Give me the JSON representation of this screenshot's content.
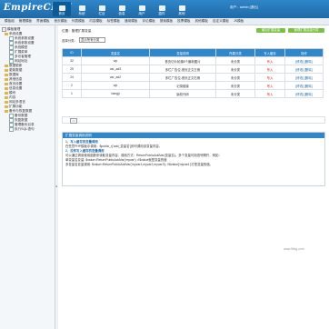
{
  "header": {
    "logo": "EmpireCMS",
    "logo_sup": "7",
    "nav": [
      {
        "label": "首页"
      },
      {
        "label": "系统"
      },
      {
        "label": "栏目"
      },
      {
        "label": "信息"
      },
      {
        "label": "用户"
      },
      {
        "label": "插件"
      },
      {
        "label": "其他"
      }
    ],
    "user": "用户：admin [退出]"
  },
  "menubar": [
    "模板组",
    "管理模板",
    "界面模板",
    "首页模板",
    "列表模板",
    "内容模板",
    "标签模板",
    "通用模板",
    "评论模板",
    "搜索模板",
    "投票模板",
    "其他模板",
    "自定义模板",
    "JS模板"
  ],
  "sidebar": {
    "items": [
      {
        "label": "模板管理",
        "level": 0,
        "type": "tree"
      },
      {
        "label": "系统设置",
        "level": 1,
        "type": "folder"
      },
      {
        "label": "系统参数设置",
        "level": 2,
        "type": "doc"
      },
      {
        "label": "系统参数设置",
        "level": 2,
        "type": "doc"
      },
      {
        "label": "系统模型",
        "level": 2,
        "type": "doc"
      },
      {
        "label": "扩展菜单",
        "level": 2,
        "type": "doc"
      },
      {
        "label": "多访者管理",
        "level": 2,
        "type": "doc"
      },
      {
        "label": "网站地址",
        "level": 2,
        "type": "doc"
      },
      {
        "label": "数据更新",
        "level": 1,
        "type": "folder"
      },
      {
        "label": "更新数据",
        "level": 1,
        "type": "folder"
      },
      {
        "label": "数据库",
        "level": 1,
        "type": "folder"
      },
      {
        "label": "其他信息",
        "level": 1,
        "type": "folder"
      },
      {
        "label": "首页设置",
        "level": 1,
        "type": "folder"
      },
      {
        "label": "信息设置",
        "level": 1,
        "type": "folder"
      },
      {
        "label": "模块",
        "level": 1,
        "type": "folder"
      },
      {
        "label": "内容",
        "level": 1,
        "type": "folder"
      },
      {
        "label": "网站多语言",
        "level": 1,
        "type": "folder"
      },
      {
        "label": "扩展功能",
        "level": 1,
        "type": "folder"
      },
      {
        "label": "备份与恢复数据",
        "level": 1,
        "type": "folder"
      },
      {
        "label": "备份数据",
        "level": 2,
        "type": "doc"
      },
      {
        "label": "恢复数据",
        "level": 2,
        "type": "doc"
      },
      {
        "label": "管理备份目录",
        "level": 2,
        "type": "doc"
      },
      {
        "label": "执行SQL语句",
        "level": 2,
        "type": "doc"
      }
    ]
  },
  "main": {
    "breadcrumb": "位置：管理扩展变量",
    "btn_add": "增加扩展变量",
    "btn_manage": "管理扩展变量分类",
    "select_label": "选择分类：",
    "select_value": "显示所有分类",
    "columns": [
      "ID",
      "变量名",
      "变量说明",
      "所属分类",
      "写入缓存",
      "操作"
    ],
    "rows": [
      {
        "id": "32",
        "name": "wp",
        "desc": "首页切片轮播5个最新图片",
        "cat": "未分类",
        "cache": "写入",
        "ops": "[修改] [删除]"
      },
      {
        "id": "25",
        "name": "var_ad3",
        "desc": "多栏广告位-首页正文左侧",
        "cat": "未分类",
        "cache": "写入",
        "ops": "[修改] [删除]"
      },
      {
        "id": "24",
        "name": "var_ad2",
        "desc": "多栏广告位-首页正文右侧",
        "cat": "未分类",
        "cache": "写入",
        "ops": "[修改] [删除]"
      },
      {
        "id": "2",
        "name": "wp",
        "desc": "记录链接",
        "cat": "未分类",
        "cache": "写入",
        "ops": "[修改] [删除]"
      },
      {
        "id": "1",
        "name": "bangji",
        "desc": "版权代码",
        "cat": "未分类",
        "cache": "写入",
        "ops": "[修改] [删除]"
      }
    ],
    "pager_btn": "<<"
  },
  "notes": {
    "title": "扩展变量调用说明",
    "h1": "1、写入缓存的变量调用",
    "p1": "在任意PHP模板中调用：$public_r['add_变量名']即可调用该变量内容。",
    "h2": "2、没有写入缓存的变量调用",
    "p2": "可以通过调用使用函数来读取变量内容。调用方式：ReturnPublicAddVar(变量名)。多个变量可用逗号隔开，例如：",
    "p3": "单变量名变量: $value=ReturnPublicAddVar('myvar'); //$value就是变量的值",
    "p4": "多变量名变量调用: $value=ReturnPublicAddVar('myvar1,myvar2,myvar3'); //$value['myvar1']才是变量的值。"
  },
  "watermark": "www.5kkg.com"
}
